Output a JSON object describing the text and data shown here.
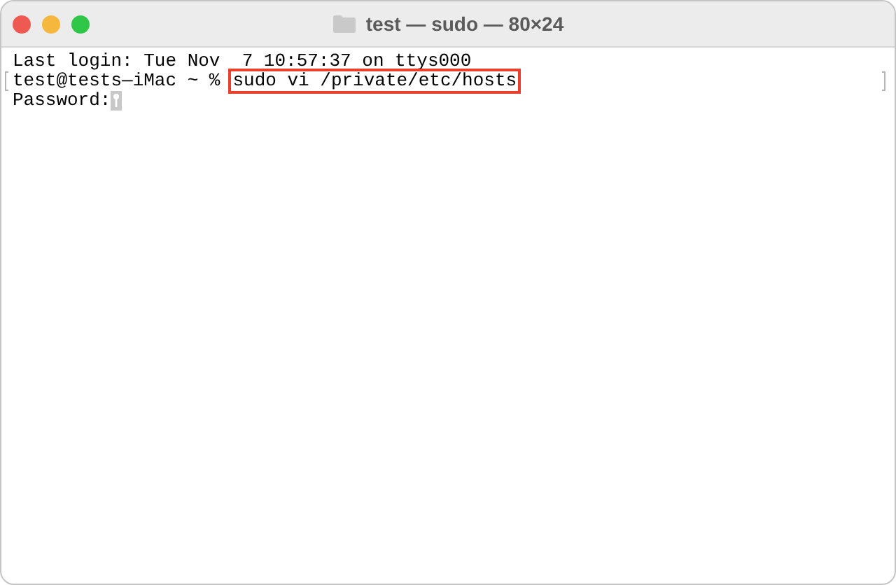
{
  "window": {
    "title": "test — sudo — 80×24"
  },
  "lines": [
    {
      "kind": "text",
      "text": "Last login: Tue Nov  7 10:57:37 on ttys000"
    },
    {
      "kind": "prompt",
      "prompt": "test@tests—iMac ~ %",
      "command": "sudo vi /private/etc/hosts",
      "highlighted": true
    },
    {
      "kind": "password",
      "text": "Password:"
    }
  ]
}
